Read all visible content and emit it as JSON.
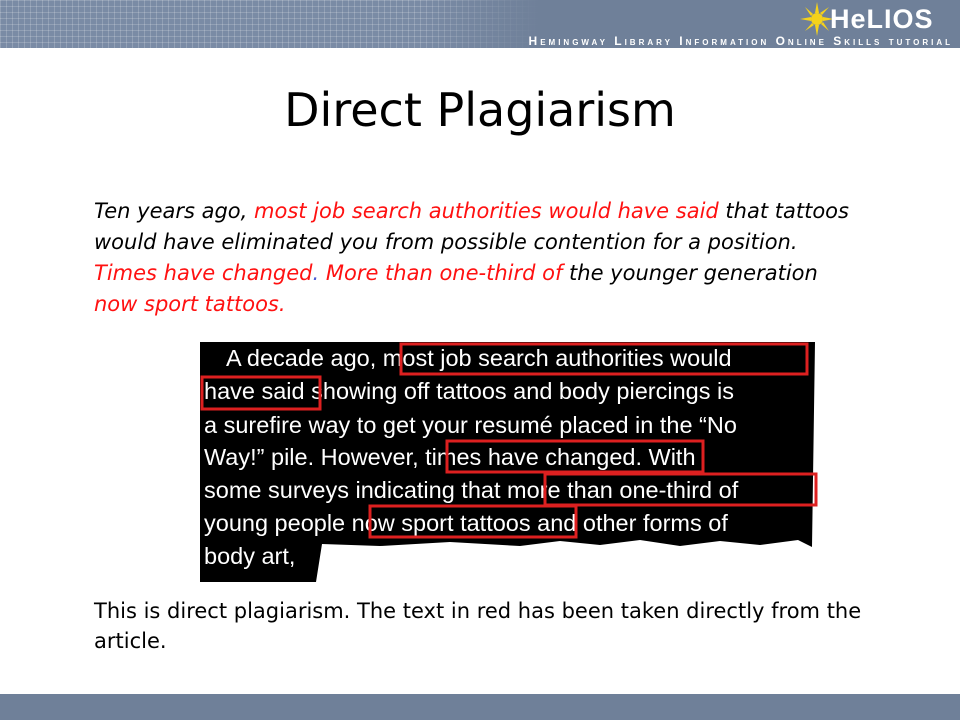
{
  "header": {
    "logo_text": "HeLIOS",
    "tagline": "Hemingway Library Information Online Skills tutorial"
  },
  "slide": {
    "title": "Direct Plagiarism",
    "quote_segments": [
      {
        "text": "Ten years ago, ",
        "color": "black"
      },
      {
        "text": "most job search authorities would have said",
        "color": "red"
      },
      {
        "text": " that tattoos would have eliminated you from possible contention for a position.  ",
        "color": "black"
      },
      {
        "text": "Times have changed",
        "color": "red"
      },
      {
        "text": ".",
        "color": "blue"
      },
      {
        "text": "  More than one-third of",
        "color": "red"
      },
      {
        "text": " the younger generation ",
        "color": "black"
      },
      {
        "text": "now sport tattoos.",
        "color": "red"
      }
    ],
    "article_lines": [
      "A decade ago, most job search authorities would",
      "have said showing off tattoos and body piercings is",
      "a surefire way to get your resumé placed in the “No",
      "Way!” pile. However, times have changed. With",
      "some surveys indicating that more than one-third of",
      "young people now sport tattoos and other forms of",
      "body art,"
    ],
    "conclusion": "This is direct plagiarism.  The text in red has been taken directly from the article."
  },
  "colors": {
    "header": "#7a8ba5",
    "highlight_red": "#ff1111",
    "box_red": "#dd2020",
    "period_blue": "#4a5bd6"
  }
}
